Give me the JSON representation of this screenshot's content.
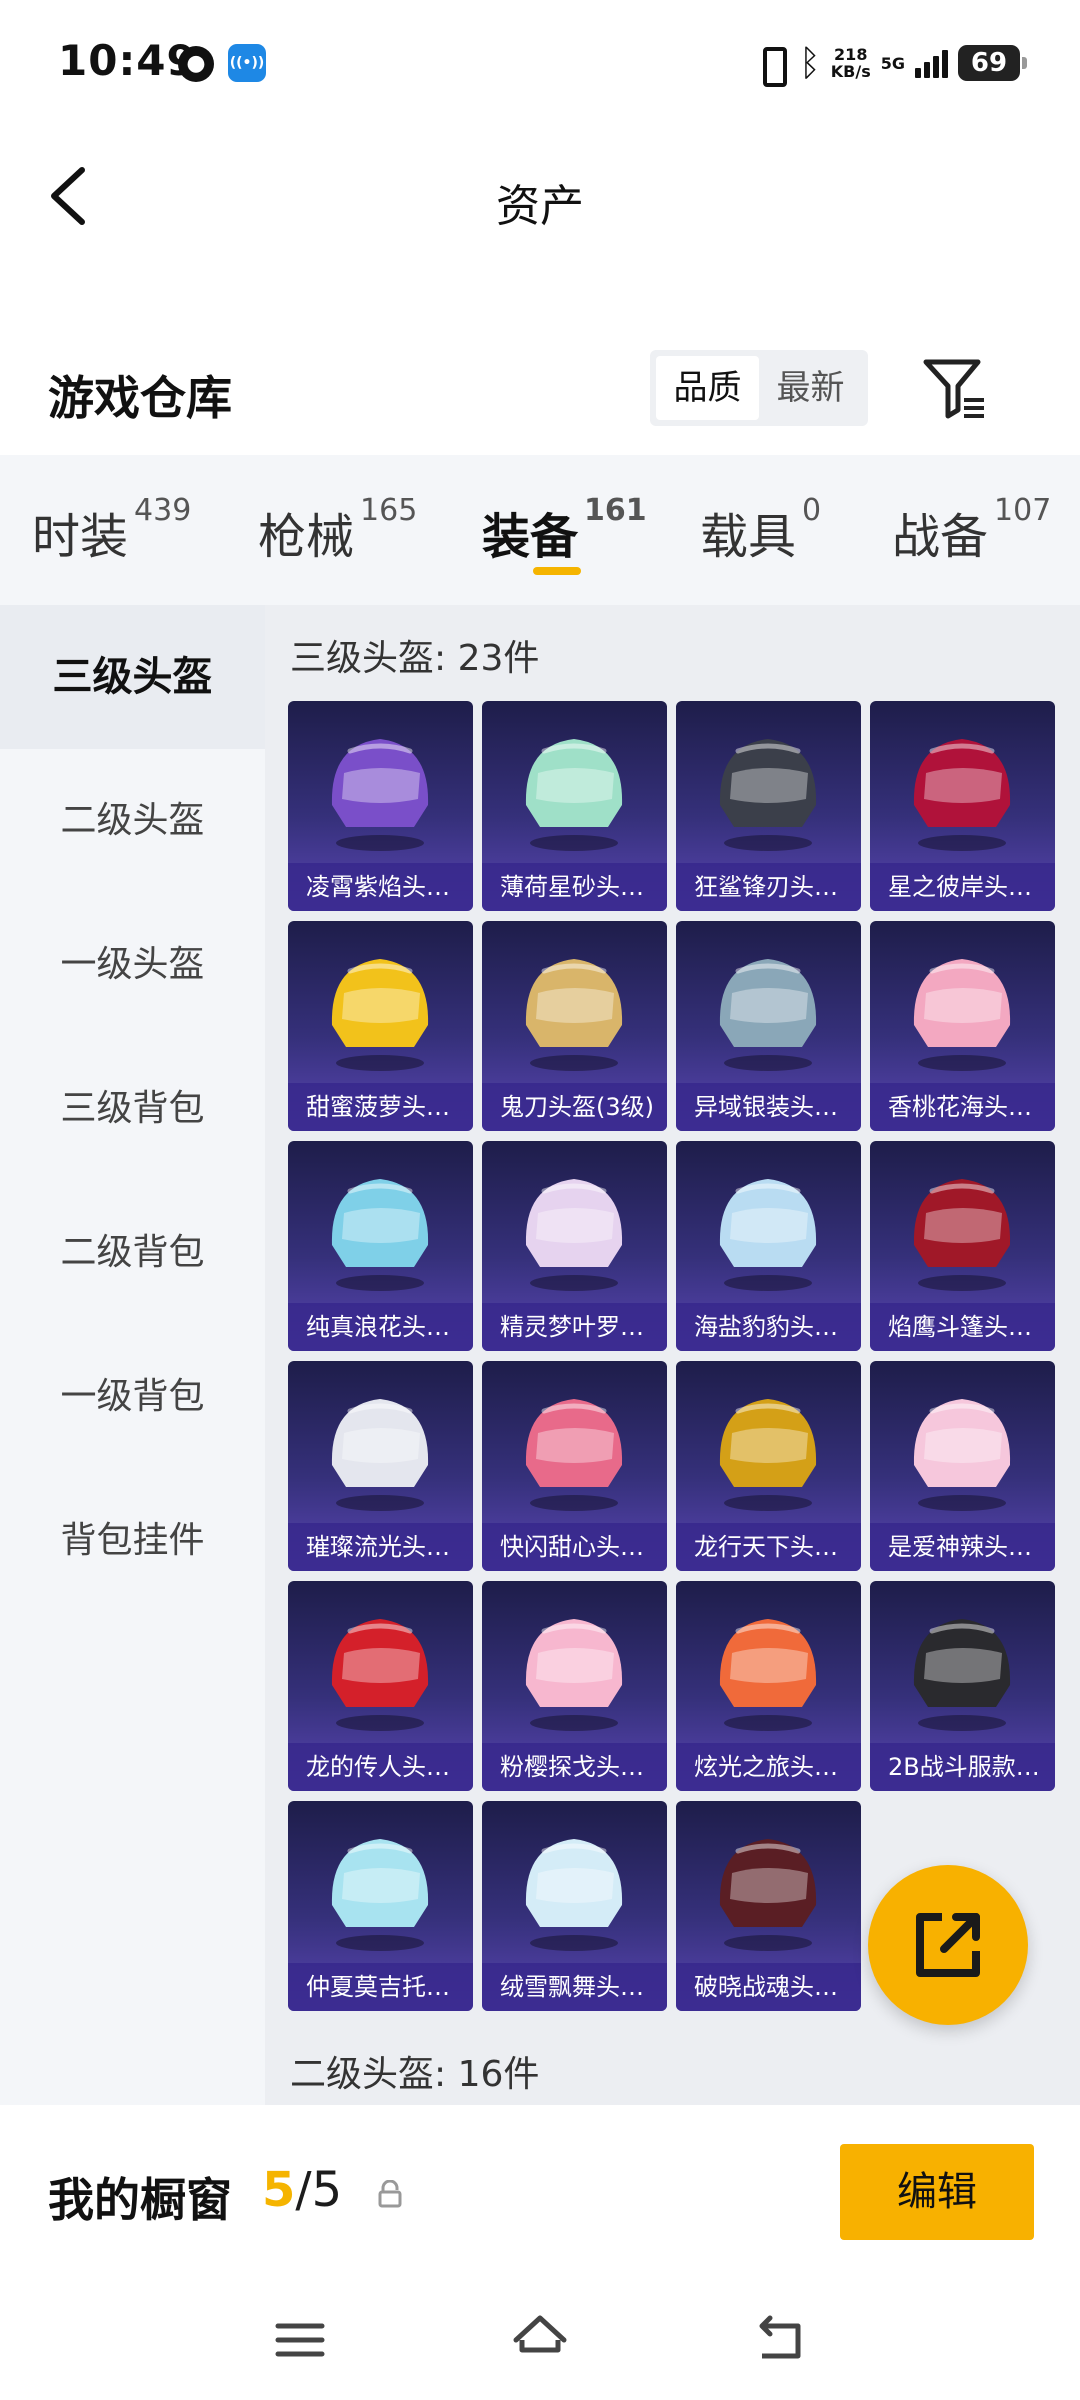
{
  "status_bar": {
    "time": "10:49",
    "speed_top": "218",
    "speed_unit": "KB/s",
    "network": "5G",
    "battery": "69"
  },
  "header": {
    "title": "资产"
  },
  "warehouse": {
    "title": "游戏仓库",
    "sort_options": [
      "品质",
      "最新"
    ],
    "sort_active": 0
  },
  "tabs": [
    {
      "label": "时装",
      "count": "439"
    },
    {
      "label": "枪械",
      "count": "165"
    },
    {
      "label": "装备",
      "count": "161"
    },
    {
      "label": "载具",
      "count": "0"
    },
    {
      "label": "战备",
      "count": "107"
    }
  ],
  "active_tab": 2,
  "sidebar": {
    "items": [
      "三级头盔",
      "二级头盔",
      "一级头盔",
      "三级背包",
      "二级背包",
      "一级背包",
      "背包挂件"
    ],
    "active": 0
  },
  "sections": [
    {
      "title": "三级头盔: 23件"
    },
    {
      "title": "二级头盔: 16件"
    }
  ],
  "items": [
    {
      "name": "凌霄紫焰头…",
      "color": "#7a4fc9"
    },
    {
      "name": "薄荷星砂头…",
      "color": "#9fe0c8"
    },
    {
      "name": "狂鲨锋刃头…",
      "color": "#3b3f4a"
    },
    {
      "name": "星之彼岸头…",
      "color": "#b0123a"
    },
    {
      "name": "甜蜜菠萝头…",
      "color": "#f2c21b"
    },
    {
      "name": "鬼刀头盔(3级)",
      "color": "#d9b56a"
    },
    {
      "name": "异域银装头…",
      "color": "#8aa7b8"
    },
    {
      "name": "香桃花海头…",
      "color": "#f3a8c1"
    },
    {
      "name": "纯真浪花头…",
      "color": "#7fd0e8"
    },
    {
      "name": "精灵梦叶罗…",
      "color": "#e6d3ef"
    },
    {
      "name": "海盐豹豹头…",
      "color": "#b9dcf2"
    },
    {
      "name": "焰鹰斗篷头…",
      "color": "#a01828"
    },
    {
      "name": "璀璨流光头…",
      "color": "#e4e6ee"
    },
    {
      "name": "快闪甜心头…",
      "color": "#e86a8a"
    },
    {
      "name": "龙行天下头…",
      "color": "#d4a017"
    },
    {
      "name": "是爱神辣头…",
      "color": "#f6c7dc"
    },
    {
      "name": "龙的传人头…",
      "color": "#d4202a"
    },
    {
      "name": "粉樱探戈头…",
      "color": "#f7b7cf"
    },
    {
      "name": "炫光之旅头…",
      "color": "#f06a3a"
    },
    {
      "name": "2B战斗服款…",
      "color": "#2a2a2e"
    },
    {
      "name": "仲夏莫吉托…",
      "color": "#a8e3f0"
    },
    {
      "name": "绒雪飘舞头…",
      "color": "#d4ecf7"
    },
    {
      "name": "破晓战魂头…",
      "color": "#5a1e24"
    }
  ],
  "showcase": {
    "label": "我的橱窗",
    "current": "5",
    "separator_total": "/5",
    "edit_label": "编辑"
  }
}
